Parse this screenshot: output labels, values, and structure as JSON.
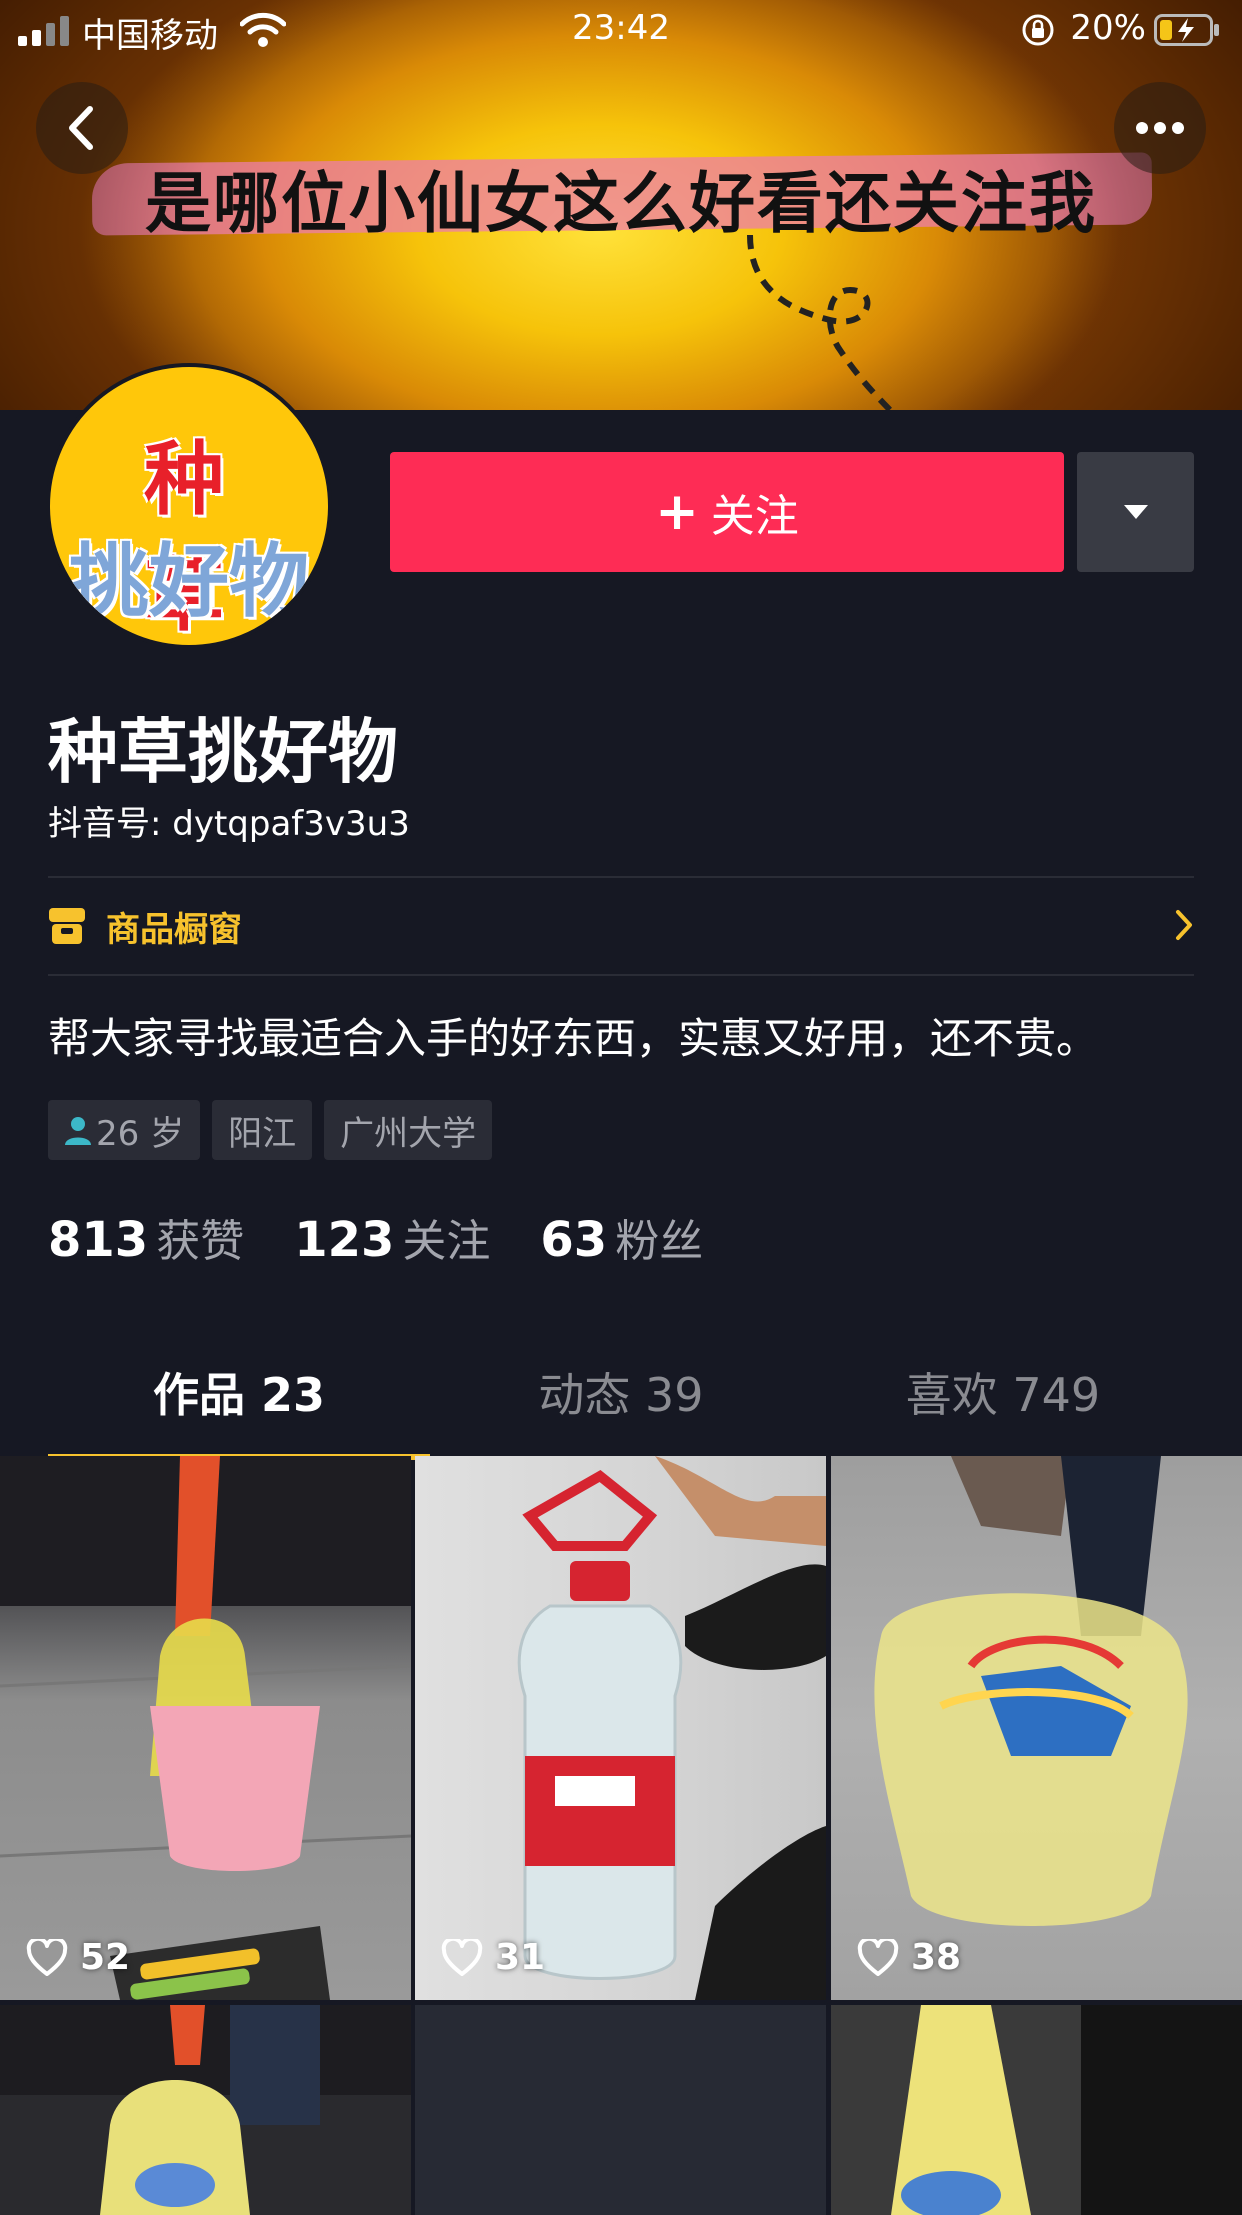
{
  "status_bar": {
    "carrier": "中国移动",
    "time": "23:42",
    "battery": "20%"
  },
  "banner": {
    "slogan": "是哪位小仙女这么好看还关注我"
  },
  "avatar": {
    "line1": "种 草",
    "line2": "挑好物"
  },
  "actions": {
    "follow_label": "关注",
    "follow_plus": "+"
  },
  "profile": {
    "nickname": "种草挑好物",
    "douyin_id": "抖音号: dytqpaf3v3u3",
    "shop_label": "商品橱窗",
    "bio": "帮大家寻找最适合入手的好东西，实惠又好用，还不贵。",
    "tags": {
      "age": "26 岁",
      "city": "阳江",
      "school": "广州大学"
    }
  },
  "stats": {
    "likes": {
      "num": "813",
      "label": "获赞"
    },
    "following": {
      "num": "123",
      "label": "关注"
    },
    "fans": {
      "num": "63",
      "label": "粉丝"
    }
  },
  "tabs": {
    "works": "作品 23",
    "dynamic": "动态 39",
    "liked": "喜欢 749"
  },
  "videos": [
    {
      "likes": "52"
    },
    {
      "likes": "31"
    },
    {
      "likes": "38"
    }
  ],
  "colors": {
    "background": "#161823",
    "follow_button": "#fe2c55",
    "accent_yellow": "#f7c22d",
    "muted_text": "#a3a5ad"
  }
}
